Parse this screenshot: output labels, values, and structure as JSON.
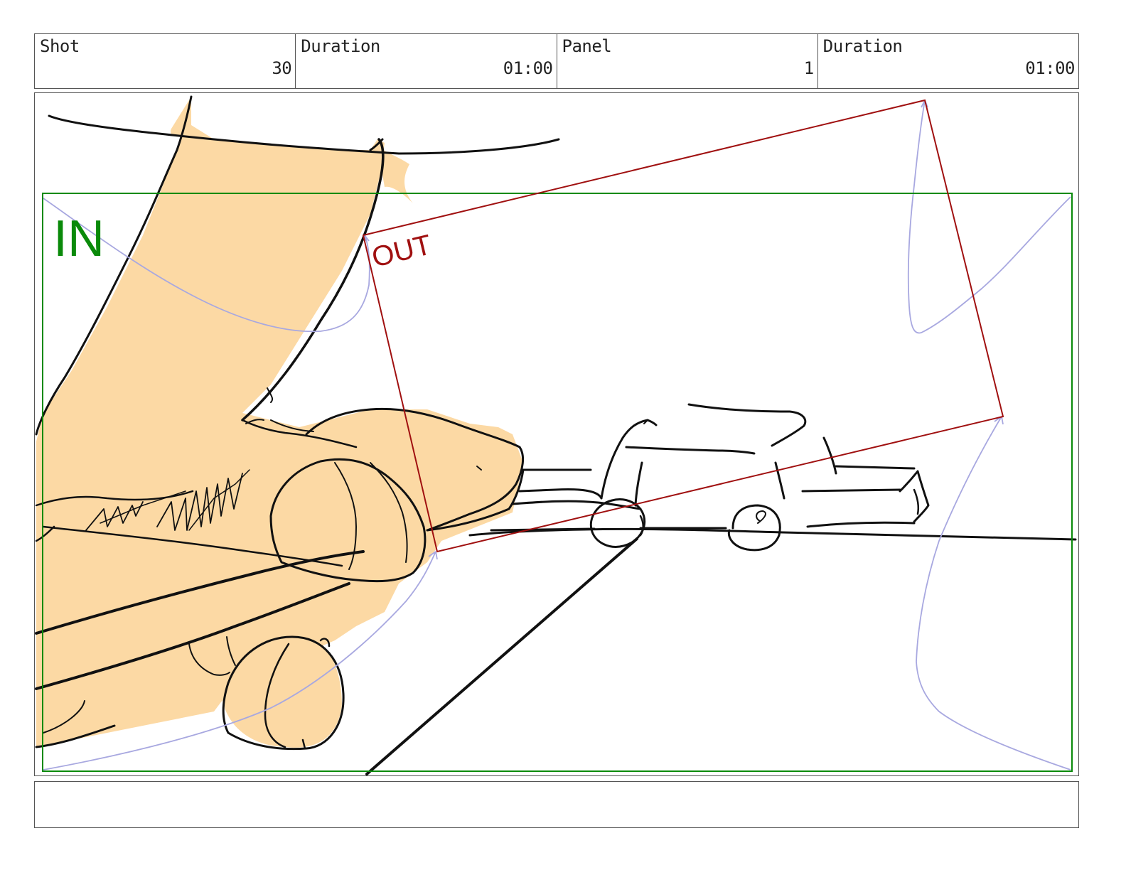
{
  "header": {
    "shot_label": "Shot",
    "shot_value": "30",
    "shot_duration_label": "Duration",
    "shot_duration_value": "01:00",
    "panel_label": "Panel",
    "panel_value": "1",
    "panel_duration_label": "Duration",
    "panel_duration_value": "01:00"
  },
  "camera": {
    "in_label": "IN",
    "out_label": "OUT",
    "in_color": "#0a8a0a",
    "out_color": "#a01010",
    "path_color": "#a8a8e0"
  },
  "colors": {
    "skin": "#fcd9a4",
    "line": "#111111"
  },
  "notes": {
    "text": ""
  }
}
